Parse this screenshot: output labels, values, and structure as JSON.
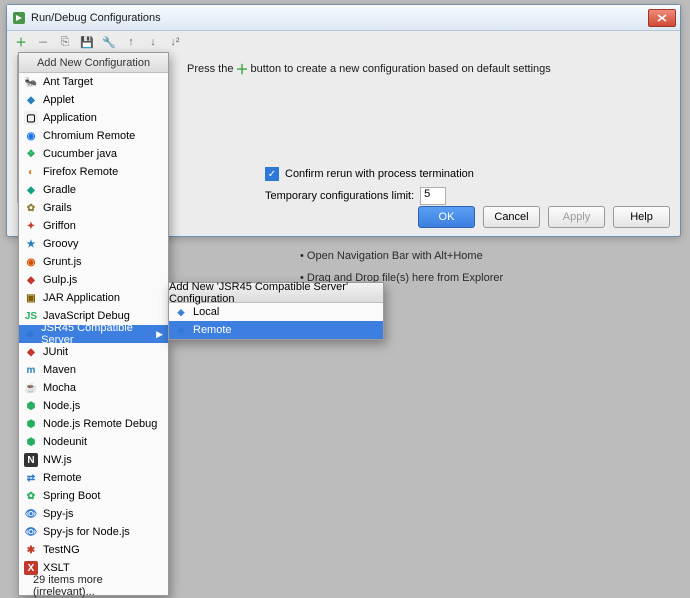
{
  "dialog": {
    "title": "Run/Debug Configurations",
    "tip_prefix": "Press the",
    "tip_suffix": " button to create a new configuration based on default settings",
    "confirm_label": "Confirm rerun with process termination",
    "confirm_checked": true,
    "limit_label": "Temporary configurations limit:",
    "limit_value": "5",
    "buttons": {
      "ok": "OK",
      "cancel": "Cancel",
      "apply": "Apply",
      "help": "Help"
    }
  },
  "hints": {
    "nav": "• Open Navigation Bar with Alt+Home",
    "dnd": "• Drag and Drop file(s) here from Explorer"
  },
  "dropdown": {
    "header": "Add New Configuration",
    "footer": "29 items more (irrelevant)...",
    "items": [
      {
        "label": "Ant Target",
        "icon": "i-ant",
        "glyph": "🐜"
      },
      {
        "label": "Applet",
        "icon": "i-applet",
        "glyph": "◆"
      },
      {
        "label": "Application",
        "icon": "i-app",
        "glyph": "▢"
      },
      {
        "label": "Chromium Remote",
        "icon": "i-chrome",
        "glyph": "◉"
      },
      {
        "label": "Cucumber java",
        "icon": "i-cuke",
        "glyph": "❖"
      },
      {
        "label": "Firefox Remote",
        "icon": "i-firefox",
        "glyph": "◐"
      },
      {
        "label": "Gradle",
        "icon": "i-gradle",
        "glyph": "◆"
      },
      {
        "label": "Grails",
        "icon": "i-grails",
        "glyph": "✿"
      },
      {
        "label": "Griffon",
        "icon": "i-griffon",
        "glyph": "✦"
      },
      {
        "label": "Groovy",
        "icon": "i-groovy",
        "glyph": "★"
      },
      {
        "label": "Grunt.js",
        "icon": "i-grunt",
        "glyph": "◉"
      },
      {
        "label": "Gulp.js",
        "icon": "i-gulp",
        "glyph": "◆"
      },
      {
        "label": "JAR Application",
        "icon": "i-jar",
        "glyph": "▣"
      },
      {
        "label": "JavaScript Debug",
        "icon": "i-js",
        "glyph": "JS"
      },
      {
        "label": "JSR45 Compatible Server",
        "icon": "i-jsr",
        "glyph": "◈",
        "selected": true,
        "hasSubmenu": true
      },
      {
        "label": "JUnit",
        "icon": "i-junit",
        "glyph": "◆"
      },
      {
        "label": "Maven",
        "icon": "i-maven",
        "glyph": "m"
      },
      {
        "label": "Mocha",
        "icon": "i-mocha",
        "glyph": "☕"
      },
      {
        "label": "Node.js",
        "icon": "i-node",
        "glyph": "⬢"
      },
      {
        "label": "Node.js Remote Debug",
        "icon": "i-node",
        "glyph": "⬢"
      },
      {
        "label": "Nodeunit",
        "icon": "i-nodeunit",
        "glyph": "⬢"
      },
      {
        "label": "NW.js",
        "icon": "i-nw",
        "glyph": "N"
      },
      {
        "label": "Remote",
        "icon": "i-remote",
        "glyph": "⇄"
      },
      {
        "label": "Spring Boot",
        "icon": "i-spring",
        "glyph": "✿"
      },
      {
        "label": "Spy-js",
        "icon": "i-spy",
        "glyph": "👁"
      },
      {
        "label": "Spy-js for Node.js",
        "icon": "i-spy",
        "glyph": "👁"
      },
      {
        "label": "TestNG",
        "icon": "i-testng",
        "glyph": "✱"
      },
      {
        "label": "XSLT",
        "icon": "i-xslt",
        "glyph": "X"
      }
    ]
  },
  "submenu": {
    "header": "Add New 'JSR45 Compatible Server' Configuration",
    "items": [
      {
        "label": "Local",
        "icon": "i-jsr",
        "glyph": "◈"
      },
      {
        "label": "Remote",
        "icon": "i-jsr",
        "glyph": "◈",
        "selected": true
      }
    ]
  }
}
